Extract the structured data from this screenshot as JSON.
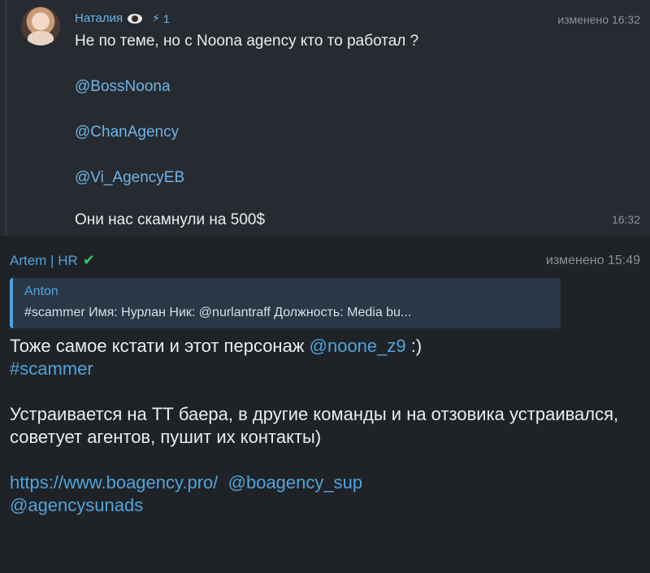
{
  "message1": {
    "sender": "Наталия",
    "boost_count": "1",
    "edited_label": "изменено 16:32",
    "text_line": "Не по теме, но с Noona agency кто то работал ?",
    "mentions": [
      "@BossNoona",
      "@ChanAgency",
      "@Vi_AgencyEB"
    ],
    "closing_line": "Они нас скамнули на 500$",
    "time": "16:32"
  },
  "message2": {
    "sender": "Artem | HR",
    "edited_label": "изменено 15:49",
    "reply": {
      "name": "Anton",
      "text": "#scammer Имя: Нурлан Ник: @nurlantraff Должность: Media bu..."
    },
    "line1_text": "Тоже самое кстати и этот персонаж ",
    "line1_mention": "@noone_z9",
    "line1_suffix": " :)",
    "hashtag": "#scammer",
    "paragraph": "Устраивается на ТТ баера, в другие команды и на отзовика устраивался, советует агентов, пушит их контакты)",
    "link": "https://www.boagency.pro/",
    "link_mention": "@boagency_sup",
    "last_mention": "@agencysunads"
  },
  "colors": {
    "background": "#1f2327",
    "accent": "#4fa3dc",
    "verified": "#39c46a"
  }
}
